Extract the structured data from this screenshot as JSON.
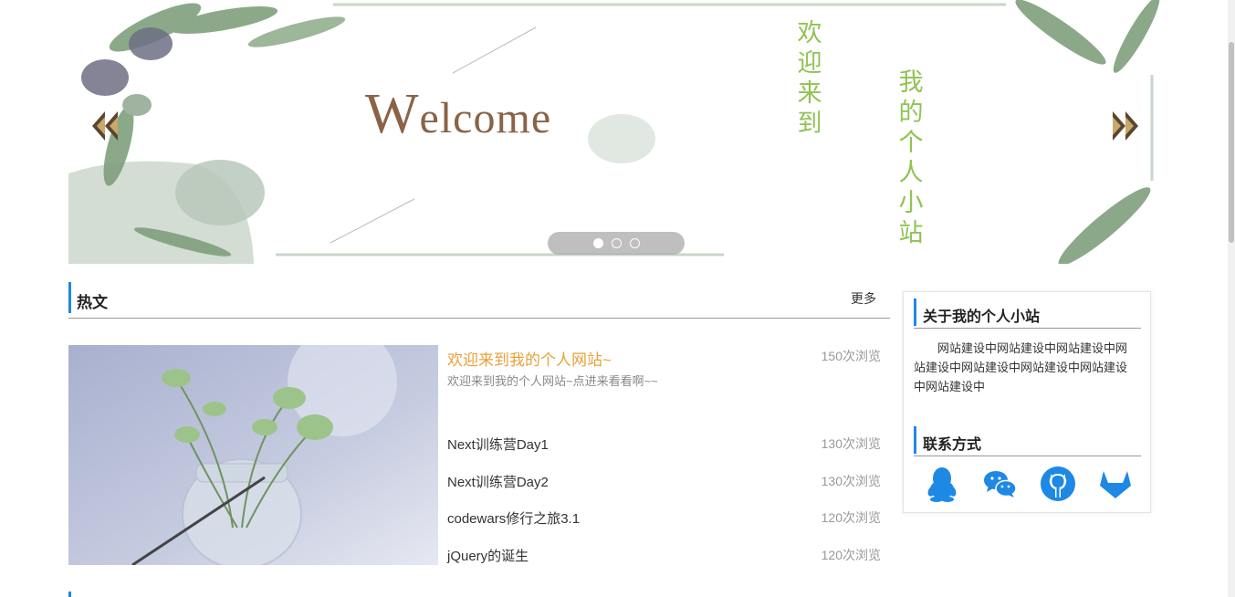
{
  "banner": {
    "welcome_initial": "W",
    "welcome_rest": "elcome",
    "vertical_text_1": "欢迎来到",
    "vertical_text_2": "我的个人小站",
    "accent_color": "#8fc352",
    "slide_count": 3,
    "active_slide": 1
  },
  "hot": {
    "title": "热文",
    "more": "更多",
    "featured": {
      "title": "欢迎来到我的个人网站~",
      "desc": "欢迎来到我的个人网站~点进来看看啊~~",
      "views": "150次浏览"
    },
    "items": [
      {
        "title": "Next训练营Day1",
        "views": "130次浏览"
      },
      {
        "title": "Next训练营Day2",
        "views": "130次浏览"
      },
      {
        "title": "codewars修行之旅3.1",
        "views": "120次浏览"
      },
      {
        "title": "jQuery的诞生",
        "views": "120次浏览"
      }
    ]
  },
  "sidebar": {
    "about_title": "关于我的个人小站",
    "about_text": "网站建设中网站建设中网站建设中网站建设中网站建设中网站建设中网站建设中网站建设中",
    "contact_title": "联系方式",
    "contacts": [
      "qq-icon",
      "wechat-icon",
      "github-icon",
      "gitlab-icon"
    ],
    "icon_color": "#1e88e5"
  }
}
